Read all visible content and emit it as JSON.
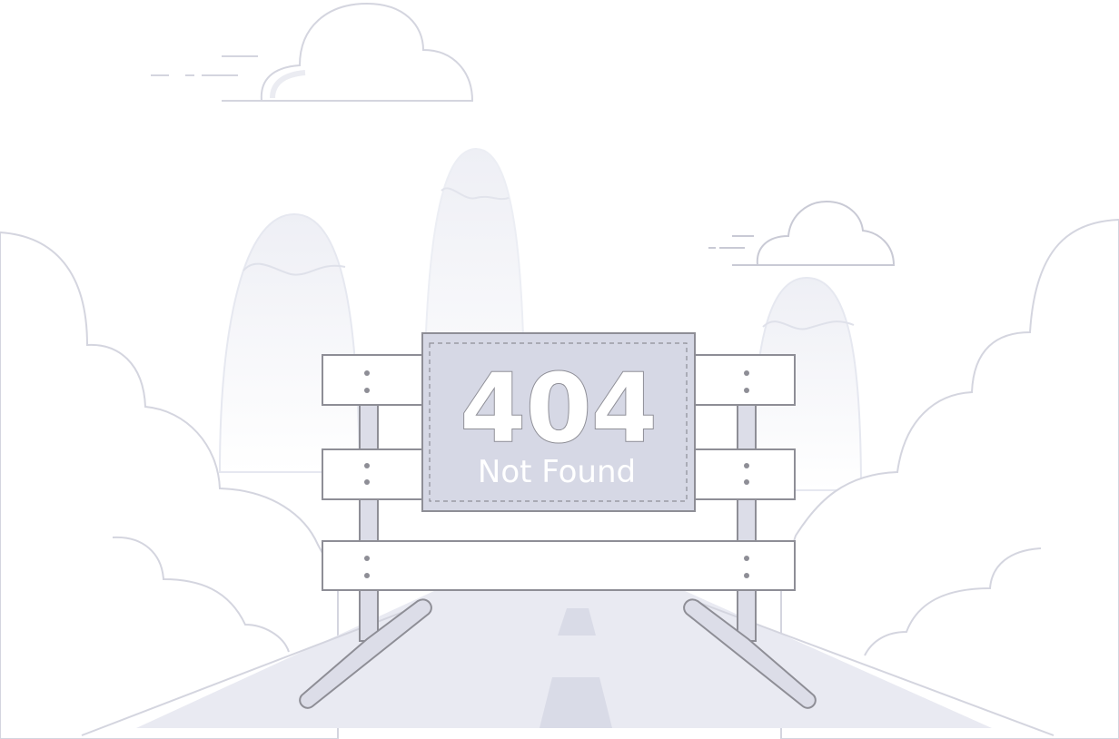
{
  "sign": {
    "code": "404",
    "message": "Not Found"
  },
  "colors": {
    "line": "#d4d5df",
    "outline": "#8e8e96",
    "sign_fill": "#d6d8e5",
    "road": "#e9eaf2",
    "lane": "#d9dbe7",
    "mountain": "#f3f4f8",
    "post": "#dcdde8"
  },
  "icons": {
    "cloud": "cloud-icon",
    "mountain": "mountain-icon",
    "barrier": "road-barrier-icon"
  }
}
